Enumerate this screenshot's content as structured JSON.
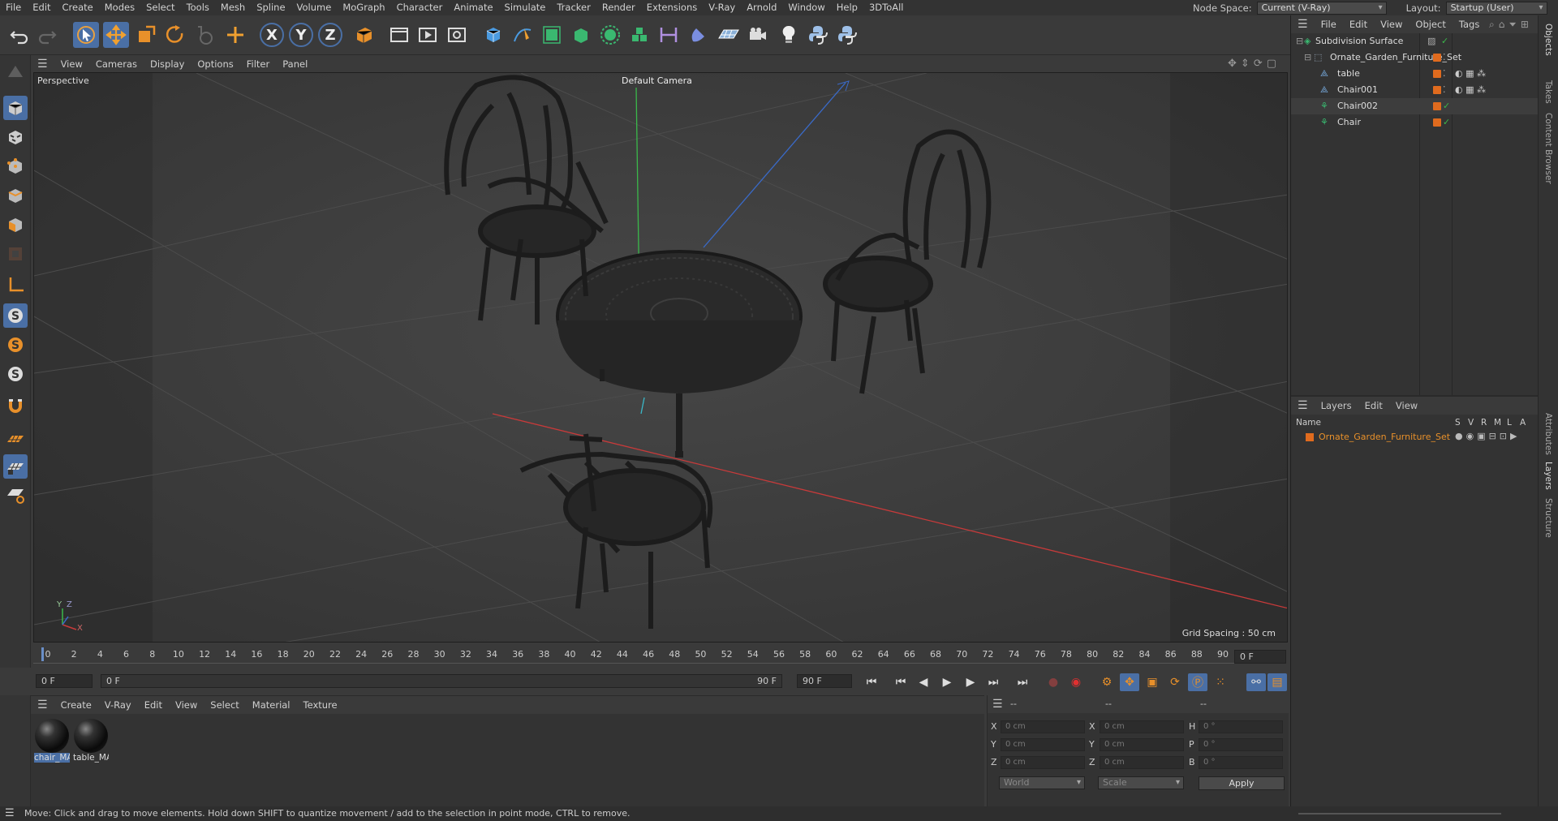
{
  "menubar": {
    "items": [
      "File",
      "Edit",
      "Create",
      "Modes",
      "Select",
      "Tools",
      "Mesh",
      "Spline",
      "Volume",
      "MoGraph",
      "Character",
      "Animate",
      "Simulate",
      "Tracker",
      "Render",
      "Extensions",
      "V-Ray",
      "Arnold",
      "Window",
      "Help",
      "3DToAll"
    ],
    "node_space_label": "Node Space:",
    "node_space_value": "Current (V-Ray)",
    "layout_label": "Layout:",
    "layout_value": "Startup (User)"
  },
  "toolbar": {
    "axis_x": "X",
    "axis_y": "Y",
    "axis_z": "Z"
  },
  "viewport": {
    "menu": [
      "View",
      "Cameras",
      "Display",
      "Options",
      "Filter",
      "Panel"
    ],
    "view_name": "Perspective",
    "camera": "Default Camera",
    "grid_spacing": "Grid Spacing : 50 cm",
    "axis_y": "Y",
    "axis_z": "Z",
    "axis_x": "X"
  },
  "timeline": {
    "ticks": [
      "0",
      "2",
      "4",
      "6",
      "8",
      "10",
      "12",
      "14",
      "16",
      "18",
      "20",
      "22",
      "24",
      "26",
      "28",
      "30",
      "32",
      "34",
      "36",
      "38",
      "40",
      "42",
      "44",
      "46",
      "48",
      "50",
      "52",
      "54",
      "56",
      "58",
      "60",
      "62",
      "64",
      "66",
      "68",
      "70",
      "72",
      "74",
      "76",
      "78",
      "80",
      "82",
      "84",
      "86",
      "88",
      "90"
    ],
    "current_frame": "0 F"
  },
  "transport": {
    "start_field": "0 F",
    "range_start": "0 F",
    "range_end": "90 F",
    "end_field": "90 F"
  },
  "materials": {
    "menu": [
      "Create",
      "V-Ray",
      "Edit",
      "View",
      "Select",
      "Material",
      "Texture"
    ],
    "items": [
      {
        "name": "chair_MA"
      },
      {
        "name": "table_MA"
      }
    ]
  },
  "coordinates": {
    "headers": [
      "--",
      "--",
      "--"
    ],
    "rows": [
      {
        "pos_label": "X",
        "pos": "0 cm",
        "size_label": "X",
        "size": "0 cm",
        "rot_label": "H",
        "rot": "0 °"
      },
      {
        "pos_label": "Y",
        "pos": "0 cm",
        "size_label": "Y",
        "size": "0 cm",
        "rot_label": "P",
        "rot": "0 °"
      },
      {
        "pos_label": "Z",
        "pos": "0 cm",
        "size_label": "Z",
        "size": "0 cm",
        "rot_label": "B",
        "rot": "0 °"
      }
    ],
    "space": "World",
    "mode": "Scale",
    "apply": "Apply"
  },
  "objects": {
    "menu": [
      "File",
      "Edit",
      "View",
      "Object",
      "Tags"
    ],
    "tree": [
      {
        "name": "Subdivision Surface"
      },
      {
        "name": "Ornate_Garden_Furniture_Set"
      },
      {
        "name": "table"
      },
      {
        "name": "Chair001"
      },
      {
        "name": "Chair002"
      },
      {
        "name": "Chair"
      }
    ]
  },
  "layers": {
    "menu": [
      "Layers",
      "Edit",
      "View"
    ],
    "columns": [
      "Name",
      "S",
      "V",
      "R",
      "M",
      "L",
      "A"
    ],
    "items": [
      {
        "name": "Ornate_Garden_Furniture_Set",
        "color": "#e06b1e"
      }
    ]
  },
  "side_tabs": [
    "Objects",
    "Takes",
    "Content Browser",
    "Attributes",
    "Layers",
    "Structure"
  ],
  "status": "Move: Click and drag to move elements. Hold down SHIFT to quantize movement / add to the selection in point mode, CTRL to remove.",
  "colors": {
    "accent": "#e06b1e",
    "selection_blue": "#4a6fa5",
    "axis_x": "#c83a3a",
    "axis_y": "#3ab84a",
    "axis_z": "#3a6ac8"
  }
}
